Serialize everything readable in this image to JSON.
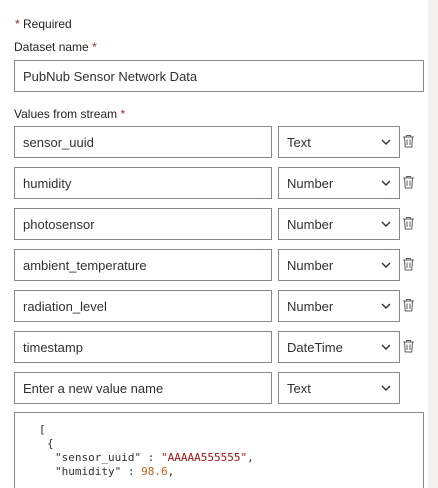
{
  "form": {
    "required_note": "Required",
    "required_marker": "*",
    "dataset_name": {
      "label": "Dataset name",
      "value": "PubNub Sensor Network Data"
    },
    "values_label": "Values from stream",
    "rows": [
      {
        "name": "sensor_uuid",
        "type": "Text"
      },
      {
        "name": "humidity",
        "type": "Number"
      },
      {
        "name": "photosensor",
        "type": "Number"
      },
      {
        "name": "ambient_temperature",
        "type": "Number"
      },
      {
        "name": "radiation_level",
        "type": "Number"
      },
      {
        "name": "timestamp",
        "type": "DateTime"
      }
    ],
    "new_row": {
      "placeholder": "Enter a new value name",
      "type": "Text"
    },
    "json_preview": {
      "open_bracket": "[",
      "open_brace": "{",
      "lines": [
        {
          "key": "\"sensor_uuid\"",
          "sep": " : ",
          "value": "\"AAAAA555555\"",
          "kind": "str",
          "end": ","
        },
        {
          "key": "\"humidity\"",
          "sep": " : ",
          "value": "98.6",
          "kind": "num",
          "end": ","
        }
      ]
    }
  },
  "icons": {
    "chevron": "chevron-down-icon",
    "delete": "trash-icon"
  },
  "colors": {
    "required_star": "#a4262c",
    "border": "#8a8886",
    "json_string": "#a31515",
    "json_number": "#c0641a"
  }
}
